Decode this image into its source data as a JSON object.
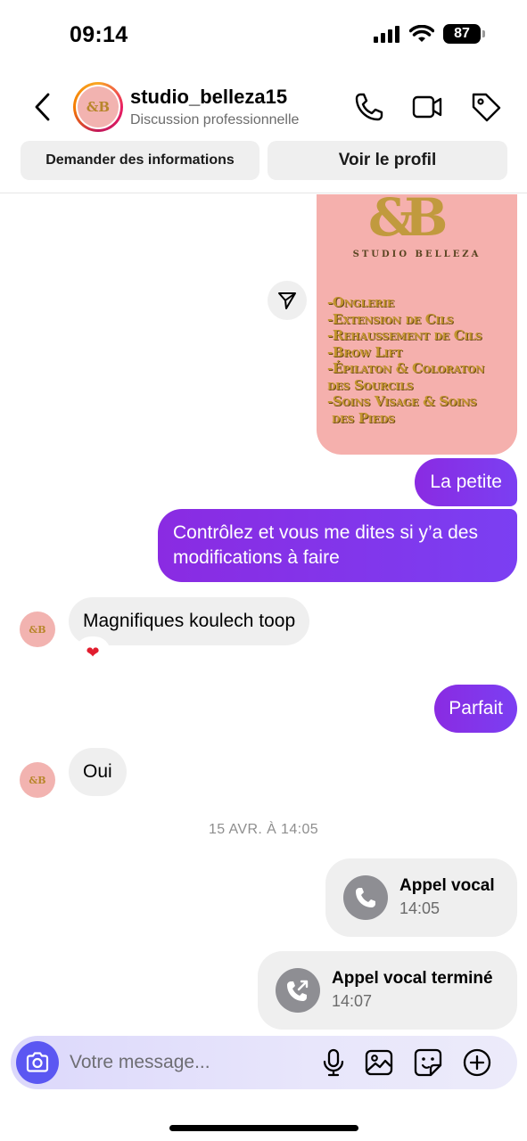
{
  "status_bar": {
    "time": "09:14",
    "battery": "87"
  },
  "header": {
    "name": "studio_belleza15",
    "subtitle": "Discussion professionnelle"
  },
  "quick_actions": {
    "request_info": "Demander des informations",
    "view_profile": "Voir le profil"
  },
  "media_card": {
    "logo": "&B",
    "brand": "STUDIO BELLEZA",
    "services": [
      "-Onglerie",
      "-Extension de Cils",
      "-Rehaussement de Cils",
      "-Brow Lift",
      "-Épilaton & Coloraton",
      "des Sourcils",
      "-Soins Visage & Soins",
      " des Pieds"
    ]
  },
  "messages": [
    {
      "direction": "outgoing",
      "text": "La petite"
    },
    {
      "direction": "outgoing",
      "text": "Contrôlez et vous me dites si y’a des modifications à faire"
    },
    {
      "direction": "incoming",
      "text": "Magnifiques koulech toop",
      "reaction": "❤"
    },
    {
      "direction": "outgoing",
      "text": "Parfait"
    },
    {
      "direction": "incoming",
      "text": "Oui"
    }
  ],
  "timestamp": "15 AVR. À 14:05",
  "calls": [
    {
      "title": "Appel vocal",
      "time": "14:05"
    },
    {
      "title": "Appel vocal terminé",
      "time": "14:07"
    }
  ],
  "composer": {
    "placeholder": "Votre message..."
  },
  "colors": {
    "outgoing_bubble": "#7b3ff2",
    "incoming_bubble": "#efefef",
    "camera_button": "#5b57f2",
    "media_card_bg": "#f5b0ad"
  }
}
